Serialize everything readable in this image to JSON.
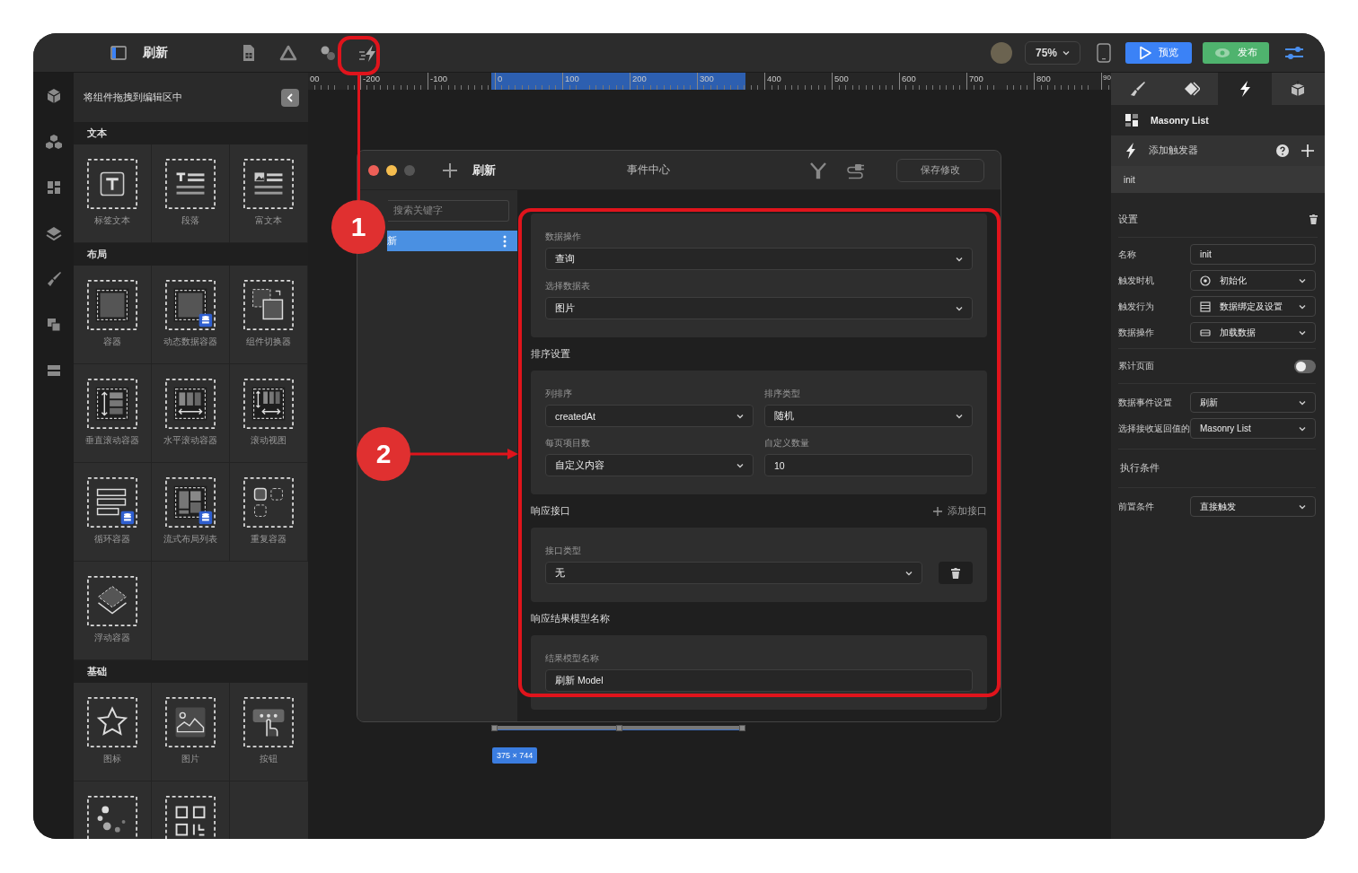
{
  "toolbar": {
    "page_title": "刷新",
    "tools": [
      {
        "kind": "sheet"
      },
      {
        "kind": "triangle"
      },
      {
        "kind": "circles"
      },
      {
        "kind": "bolt"
      }
    ],
    "zoom": "75%",
    "preview_button": "预览",
    "publish_button": "发布"
  },
  "rail": [
    {
      "kind": "cube"
    },
    {
      "kind": "cubes"
    },
    {
      "kind": "blocks"
    },
    {
      "kind": "layers"
    },
    {
      "kind": "brush"
    },
    {
      "kind": "pages"
    },
    {
      "kind": "rows"
    }
  ],
  "component_panel": {
    "hint": "将组件拖拽到编辑区中",
    "sections": [
      {
        "title": "文本",
        "items": [
          {
            "kind": "label",
            "label": "标签文本"
          },
          {
            "kind": "paragraph",
            "label": "段落"
          },
          {
            "kind": "richtext",
            "label": "富文本"
          }
        ]
      },
      {
        "title": "布局",
        "items": [
          {
            "kind": "container",
            "label": "容器"
          },
          {
            "kind": "datacontainer",
            "label": "动态数据容器"
          },
          {
            "kind": "switcher",
            "label": "组件切换器"
          },
          {
            "kind": "vscroll",
            "label": "垂直滚动容器"
          },
          {
            "kind": "hscroll",
            "label": "水平滚动容器"
          },
          {
            "kind": "scrollview",
            "label": "滚动视图"
          },
          {
            "kind": "loop",
            "label": "循环容器"
          },
          {
            "kind": "masonry",
            "label": "流式布局列表"
          },
          {
            "kind": "repeat",
            "label": "重复容器"
          },
          {
            "kind": "float",
            "label": "浮动容器"
          }
        ]
      },
      {
        "title": "基础",
        "items": [
          {
            "kind": "icon",
            "label": "图标"
          },
          {
            "kind": "image",
            "label": "图片"
          },
          {
            "kind": "button",
            "label": "按钮"
          },
          {
            "kind": "loading"
          },
          {
            "kind": "qr"
          }
        ]
      }
    ]
  },
  "ruler": {
    "labels": [
      "00",
      "-200",
      "-100",
      "0",
      "100",
      "200",
      "300",
      "400",
      "500",
      "600",
      "700",
      "800",
      "90"
    ]
  },
  "canvas": {
    "size_badge": "375 × 744"
  },
  "event_dialog": {
    "title": "刷新",
    "center_title": "事件中心",
    "save_button": "保存修改",
    "search": {
      "placeholder": "搜索关键字"
    },
    "events": [
      {
        "label": "新",
        "selected": true
      }
    ],
    "sections": [
      {
        "kind": "single",
        "fields": [
          {
            "kind": "select",
            "label": "数据操作",
            "value": "查询"
          },
          {
            "kind": "select",
            "label": "选择数据表",
            "value": "图片"
          }
        ]
      },
      {
        "kind": "double",
        "title": "排序设置",
        "fields": [
          {
            "kind": "select",
            "label": "列排序",
            "value": "createdAt"
          },
          {
            "kind": "select",
            "label": "排序类型",
            "value": "随机"
          },
          {
            "kind": "select",
            "label": "每页项目数",
            "value": "自定义内容"
          },
          {
            "kind": "input",
            "label": "自定义数量",
            "value": "10"
          }
        ]
      },
      {
        "kind": "single",
        "title": "响应接口",
        "action": "添加接口",
        "fields": [
          {
            "kind": "select-delete",
            "label": "接口类型",
            "value": "无"
          }
        ]
      },
      {
        "kind": "single",
        "title": "响应结果模型名称",
        "fields": [
          {
            "kind": "input",
            "label": "结果模型名称",
            "value": "刷新 Model"
          }
        ]
      }
    ]
  },
  "right_panel": {
    "tabs": [
      {
        "kind": "brush",
        "selected": false
      },
      {
        "kind": "diamond",
        "selected": false
      },
      {
        "kind": "bolt",
        "selected": true
      },
      {
        "kind": "box",
        "selected": false
      }
    ],
    "component": "Masonry List",
    "add_trigger": "添加触发器",
    "triggers": [
      {
        "label": "init",
        "selected": true
      }
    ],
    "settings_title": "设置",
    "rows": [
      {
        "kind": "input",
        "label": "名称",
        "value": "init"
      },
      {
        "kind": "icon-select",
        "label": "触发时机",
        "value": "初始化"
      },
      {
        "kind": "icon-select",
        "label": "触发行为",
        "value": "数据绑定及设置"
      },
      {
        "kind": "icon-select",
        "label": "数据操作",
        "value": "加载数据"
      },
      {
        "kind": "toggle",
        "label": "累计页面",
        "on": false
      },
      {
        "kind": "select",
        "label": "数据事件设置",
        "value": "刷新"
      },
      {
        "kind": "select",
        "label": "选择接收返回值的",
        "value": "Masonry List"
      },
      {
        "kind": "heading",
        "label": "执行条件"
      },
      {
        "kind": "select",
        "label": "前置条件",
        "value": "直接触发"
      }
    ]
  },
  "callouts": [
    {
      "number": "1"
    },
    {
      "number": "2"
    }
  ]
}
